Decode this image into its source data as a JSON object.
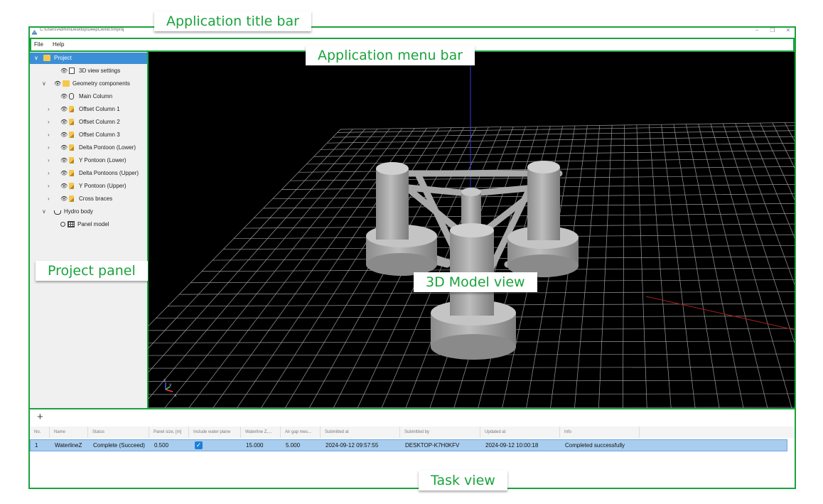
{
  "titlebar": {
    "path": "C:\\Users\\Admin\\Desktop\\DeepCwind.hmproj",
    "minimize": "–",
    "restore": "❐",
    "close": "✕"
  },
  "menu": {
    "items": [
      "File",
      "Help"
    ]
  },
  "tree": [
    {
      "label": "Project",
      "icon": "folder-icon",
      "arrow": "∨",
      "eye": false,
      "level": 0,
      "selected": true
    },
    {
      "label": "3D view settings",
      "icon": "document-icon",
      "arrow": "",
      "eye": true,
      "level": 2
    },
    {
      "label": "Geometry components",
      "icon": "folder-icon",
      "arrow": "∨",
      "eye": true,
      "level": 1
    },
    {
      "label": "Main Column",
      "icon": "cylinder-icon",
      "arrow": "",
      "eye": true,
      "level": 3
    },
    {
      "label": "Offset Column 1",
      "icon": "pencil-icon",
      "arrow": "›",
      "eye": true,
      "level": 2
    },
    {
      "label": "Offset Column 2",
      "icon": "pencil-icon",
      "arrow": "›",
      "eye": true,
      "level": 2
    },
    {
      "label": "Offset Column 3",
      "icon": "pencil-icon",
      "arrow": "›",
      "eye": true,
      "level": 2
    },
    {
      "label": "Delta Pontoon (Lower)",
      "icon": "pencil-icon",
      "arrow": "›",
      "eye": true,
      "level": 2
    },
    {
      "label": "Y Pontoon (Lower)",
      "icon": "pencil-icon",
      "arrow": "›",
      "eye": true,
      "level": 2
    },
    {
      "label": "Delta Pontoons (Upper)",
      "icon": "pencil-icon",
      "arrow": "›",
      "eye": true,
      "level": 2
    },
    {
      "label": "Y Pontoon (Upper)",
      "icon": "pencil-icon",
      "arrow": "›",
      "eye": true,
      "level": 2
    },
    {
      "label": "Cross braces",
      "icon": "pencil-icon",
      "arrow": "›",
      "eye": true,
      "level": 2
    },
    {
      "label": "Hydro body",
      "icon": "boat-icon",
      "arrow": "∨",
      "eye": false,
      "level": 1
    },
    {
      "label": "Panel model",
      "icon": "grid-icon",
      "arrow": "",
      "eye": false,
      "radio": true,
      "level": 2
    }
  ],
  "view3d": {
    "axis_labels": [
      "z",
      "y",
      "x"
    ]
  },
  "task": {
    "add_label": "+",
    "columns": [
      "No.",
      "Name",
      "Status",
      "Panel size, [m]",
      "Include water plane",
      "Waterline Z,...",
      "Air gap mes...",
      "Submitted at",
      "Submitted by",
      "Updated at",
      "Info"
    ],
    "row": {
      "no": "1",
      "name": "WaterlineZ",
      "status": "Complete (Succeed)",
      "panel_size": "0.500",
      "include_water_plane": true,
      "waterline_z": "15.000",
      "air_gap": "5.000",
      "submitted_at": "2024-09-12 09:57:55",
      "submitted_by": "DESKTOP-K7H0KFV",
      "updated_at": "2024-09-12 10:00:18",
      "info": "Completed successfully"
    }
  },
  "callouts": {
    "title_bar": "Application title bar",
    "menu_bar": "Application menu bar",
    "project_panel": "Project panel",
    "model_view": "3D Model view",
    "task_view": "Task view"
  },
  "colors": {
    "annotation_green": "#1aa33c",
    "selection_blue": "#3b8fd6",
    "row_highlight": "#a9cdef"
  }
}
